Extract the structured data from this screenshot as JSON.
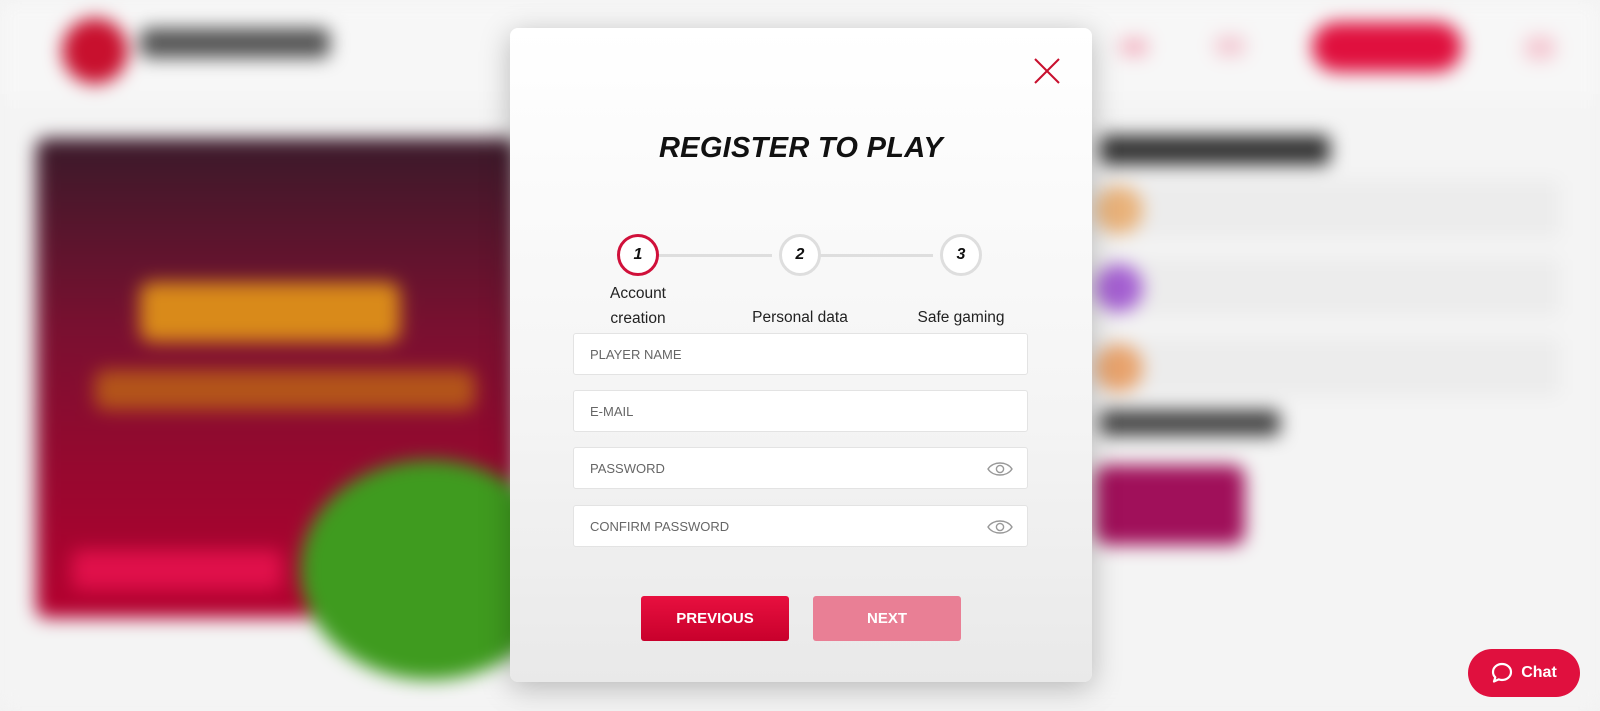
{
  "modal": {
    "title": "REGISTER TO PLAY",
    "close_icon": "close-icon"
  },
  "steps": [
    {
      "number": "1",
      "label_line1": "Account",
      "label_line2": "creation",
      "active": true
    },
    {
      "number": "2",
      "label": "Personal data",
      "active": false
    },
    {
      "number": "3",
      "label": "Safe gaming",
      "active": false
    }
  ],
  "form": {
    "player_name": {
      "placeholder": "PLAYER NAME",
      "value": ""
    },
    "email": {
      "placeholder": "E-MAIL",
      "value": ""
    },
    "password": {
      "placeholder": "PASSWORD",
      "value": "",
      "icon": "eye-icon"
    },
    "confirm_password": {
      "placeholder": "CONFIRM PASSWORD",
      "value": "",
      "icon": "eye-icon"
    }
  },
  "buttons": {
    "previous": "PREVIOUS",
    "next": "NEXT"
  },
  "chat": {
    "label": "Chat",
    "icon": "chat-bubble-icon"
  },
  "colors": {
    "accent": "#d0103a",
    "next_disabled": "#e97f95",
    "chat_bg": "#e0103e"
  }
}
